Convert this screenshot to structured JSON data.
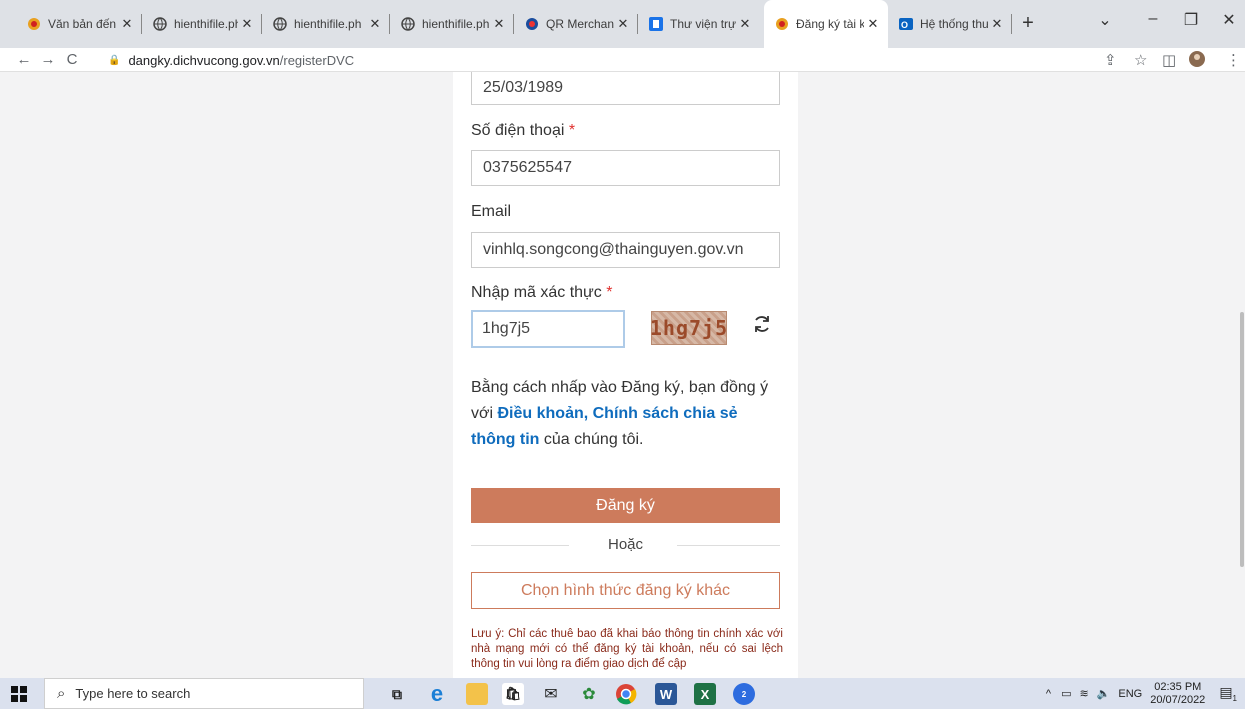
{
  "browser": {
    "tabs": [
      {
        "label": "Văn bản đến",
        "favicon": "orange-emblem-icon"
      },
      {
        "label": "hienthifile.ph",
        "favicon": "globe-icon"
      },
      {
        "label": "hienthifile.ph",
        "favicon": "globe-icon"
      },
      {
        "label": "hienthifile.ph",
        "favicon": "globe-icon"
      },
      {
        "label": "QR Merchant",
        "favicon": "qr-merchant-icon"
      },
      {
        "label": "Thư viện trực",
        "favicon": "library-icon"
      },
      {
        "label": "Đăng ký tài k",
        "favicon": "orange-emblem-icon",
        "active": true
      },
      {
        "label": "Hệ thống thư",
        "favicon": "outlook-icon"
      }
    ],
    "url_domain": "dangky.dichvucong.gov.vn",
    "url_path": "/registerDVC"
  },
  "form": {
    "dob_value": "25/03/1989",
    "phone_label": "Số điện thoại",
    "phone_value": "0375625547",
    "email_label": "Email",
    "email_value": "vinhlq.songcong@thainguyen.gov.vn",
    "captcha_label": "Nhập mã xác thực",
    "captcha_value": "1hg7j5",
    "captcha_image_text": "1hg7j5",
    "required_mark": "*",
    "consent_prefix": "Bằng cách nhấp vào Đăng ký, bạn đồng ý với",
    "consent_link": "Điều khoản, Chính sách chia sẻ thông tin",
    "consent_suffix": "của chúng tôi.",
    "register_button": "Đăng ký",
    "or_text": "Hoặc",
    "other_button": "Chọn hình thức đăng ký khác",
    "note": "Lưu ý: Chỉ các thuê bao đã khai báo thông tin chính xác với nhà mạng mới có thể đăng ký tài khoản, nếu có sai lệch thông tin vui lòng ra điểm giao dịch để cập"
  },
  "taskbar": {
    "search_placeholder": "Type here to search",
    "language": "ENG",
    "time": "02:35 PM",
    "date": "20/07/2022",
    "notification_count": "1",
    "badge_count": "2"
  },
  "colors": {
    "accent": "#cd7b5c",
    "link": "#0f6cbd",
    "required": "#e0312e"
  }
}
